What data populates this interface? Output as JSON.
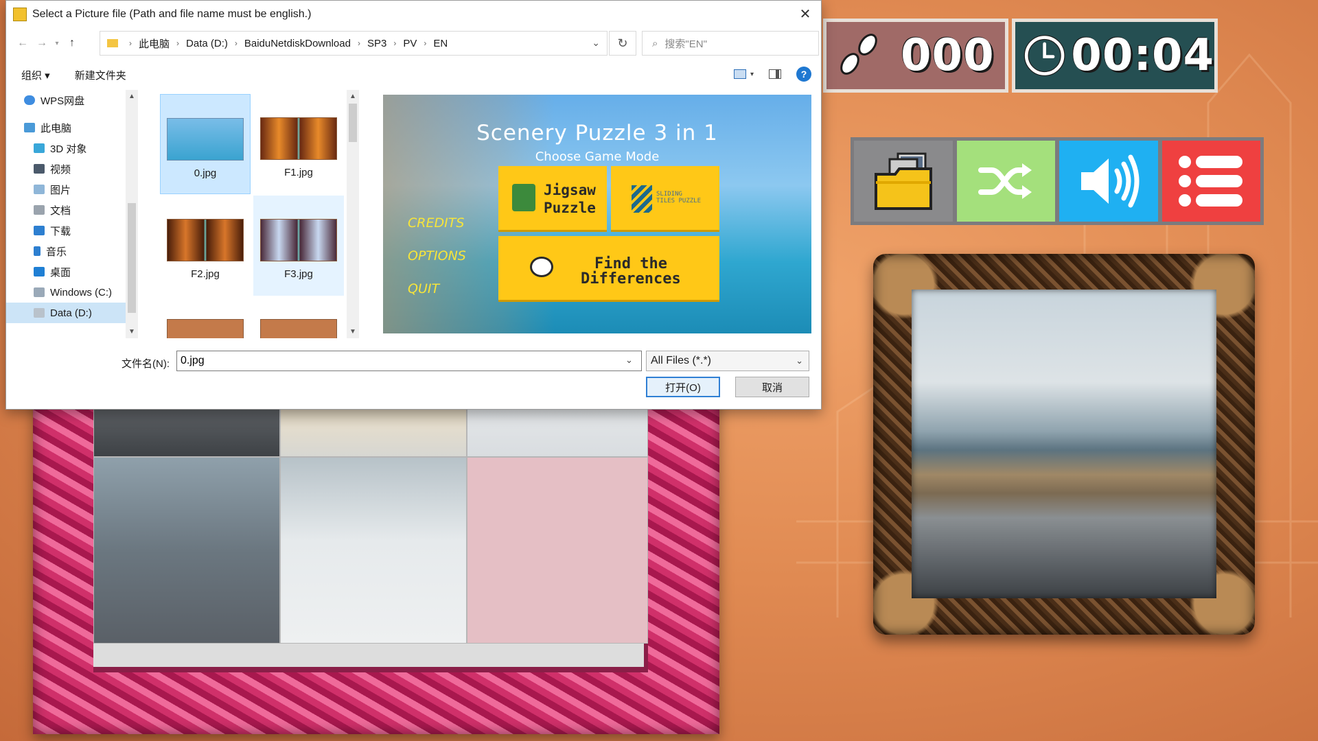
{
  "game": {
    "moves": "000",
    "time": "00:04",
    "buttons": [
      {
        "name": "open-picture-button",
        "icon": "folder-photos-icon"
      },
      {
        "name": "shuffle-button",
        "icon": "shuffle-icon"
      },
      {
        "name": "sound-button",
        "icon": "speaker-icon"
      },
      {
        "name": "menu-button",
        "icon": "list-icon"
      }
    ],
    "colors": {
      "moves_bg": "#a06a67",
      "time_bg": "#254f52",
      "shuffle": "#a4e07c",
      "sound": "#1fb0f2",
      "menu": "#ef4040"
    }
  },
  "dialog": {
    "title": "Select a Picture file (Path and file name must be english.)",
    "breadcrumb": [
      "此电脑",
      "Data (D:)",
      "BaiduNetdiskDownload",
      "SP3",
      "PV",
      "EN"
    ],
    "search_placeholder": "搜索\"EN\"",
    "toolbar": {
      "organize": "组织 ▾",
      "new_folder": "新建文件夹"
    },
    "tree": {
      "items": [
        "WPS网盘",
        "此电脑",
        "3D 对象",
        "视频",
        "图片",
        "文档",
        "下载",
        "音乐",
        "桌面",
        "Windows (C:)",
        "Data (D:)"
      ]
    },
    "files": [
      "0.jpg",
      "F1.jpg",
      "F2.jpg",
      "F3.jpg"
    ],
    "preview": {
      "title": "Scenery Puzzle 3 in 1",
      "subtitle": "Choose Game Mode",
      "jigsaw": "Jigsaw\nPuzzle",
      "sliding": "SLIDING\nTILES PUZZLE",
      "find_l1": "Find the",
      "find_l2": "Differences",
      "side": [
        "CREDITS",
        "OPTIONS",
        "QUIT"
      ]
    },
    "filename_label": "文件名(N):",
    "filename_value": "0.jpg",
    "filter_value": "All Files (*.*)",
    "open_button": "打开(O)",
    "cancel_button": "取消"
  }
}
